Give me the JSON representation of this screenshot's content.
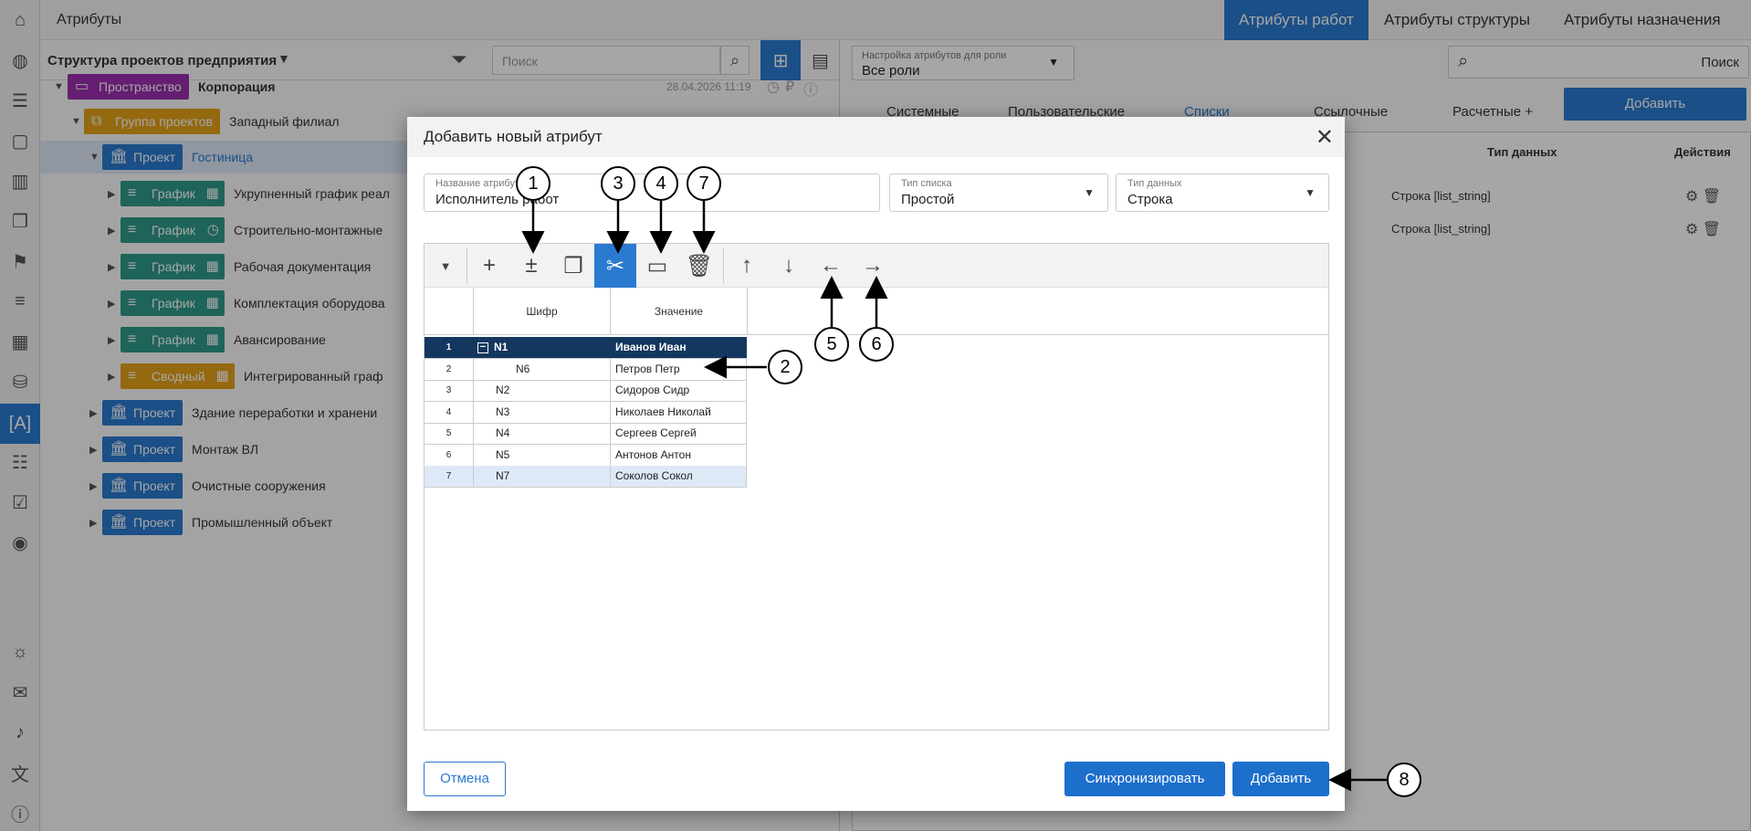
{
  "app": {
    "title": "Атрибуты",
    "top_tabs": [
      "Атрибуты работ",
      "Атрибуты структуры",
      "Атрибуты назначения"
    ]
  },
  "left_panel": {
    "structure_label": "Структура проектов предприятия",
    "search_placeholder": "Поиск",
    "tree": [
      {
        "chip": "Пространство",
        "name": "Корпорация",
        "date": "28.04.2026 11:19"
      },
      {
        "chip": "Группа проектов",
        "name": "Западный филиал"
      },
      {
        "chip": "Проект",
        "name": "Гостиница"
      },
      {
        "chip": "График",
        "name": "Укрупненный график реал"
      },
      {
        "chip": "График",
        "name": "Строительно-монтажные"
      },
      {
        "chip": "График",
        "name": "Рабочая документация"
      },
      {
        "chip": "График",
        "name": "Комплектация оборудова"
      },
      {
        "chip": "График",
        "name": "Авансирование"
      },
      {
        "chip": "Сводный",
        "name": "Интегрированный граф"
      },
      {
        "chip": "Проект",
        "name": "Здание переработки и хранени"
      },
      {
        "chip": "Проект",
        "name": "Монтаж ВЛ"
      },
      {
        "chip": "Проект",
        "name": "Очистные сооружения"
      },
      {
        "chip": "Проект",
        "name": "Промышленный объект"
      }
    ]
  },
  "right_panel": {
    "role_label": "Настройка атрибутов для роли",
    "role_value": "Все роли",
    "search_text": "Поиск",
    "tabs": [
      "Системные",
      "Пользовательские",
      "Списки",
      "Ссылочные",
      "Расчетные +"
    ],
    "add_label": "Добавить",
    "col_type": "Тип данных",
    "col_actions": "Действия",
    "rows": [
      "Строка [list_string]",
      "Строка [list_string]"
    ]
  },
  "dialog": {
    "title": "Добавить новый атрибут",
    "name_label": "Название атрибута",
    "name_value": "Исполнитель работ",
    "list_type_label": "Тип списка",
    "list_type_value": "Простой",
    "data_type_label": "Тип данных",
    "data_type_value": "Строка",
    "col_code": "Шифр",
    "col_value": "Значение",
    "rows": [
      {
        "n": "1",
        "code": "N1",
        "value": "Иванов Иван"
      },
      {
        "n": "2",
        "code": "N6",
        "value": "Петров Петр"
      },
      {
        "n": "3",
        "code": "N2",
        "value": "Сидоров Сидр"
      },
      {
        "n": "4",
        "code": "N3",
        "value": "Николаев Николай"
      },
      {
        "n": "5",
        "code": "N4",
        "value": "Сергеев Сергей"
      },
      {
        "n": "6",
        "code": "N5",
        "value": "Антонов Антон"
      },
      {
        "n": "7",
        "code": "N7",
        "value": "Соколов Сокол"
      }
    ],
    "cancel_label": "Отмена",
    "sync_label": "Синхронизировать",
    "add_label": "Добавить"
  },
  "callouts": [
    "1",
    "2",
    "3",
    "4",
    "5",
    "6",
    "7",
    "8"
  ],
  "colors": {
    "accent": "#2a7ad0",
    "selected_row": "#14375f",
    "light_row": "#dde9f7"
  }
}
